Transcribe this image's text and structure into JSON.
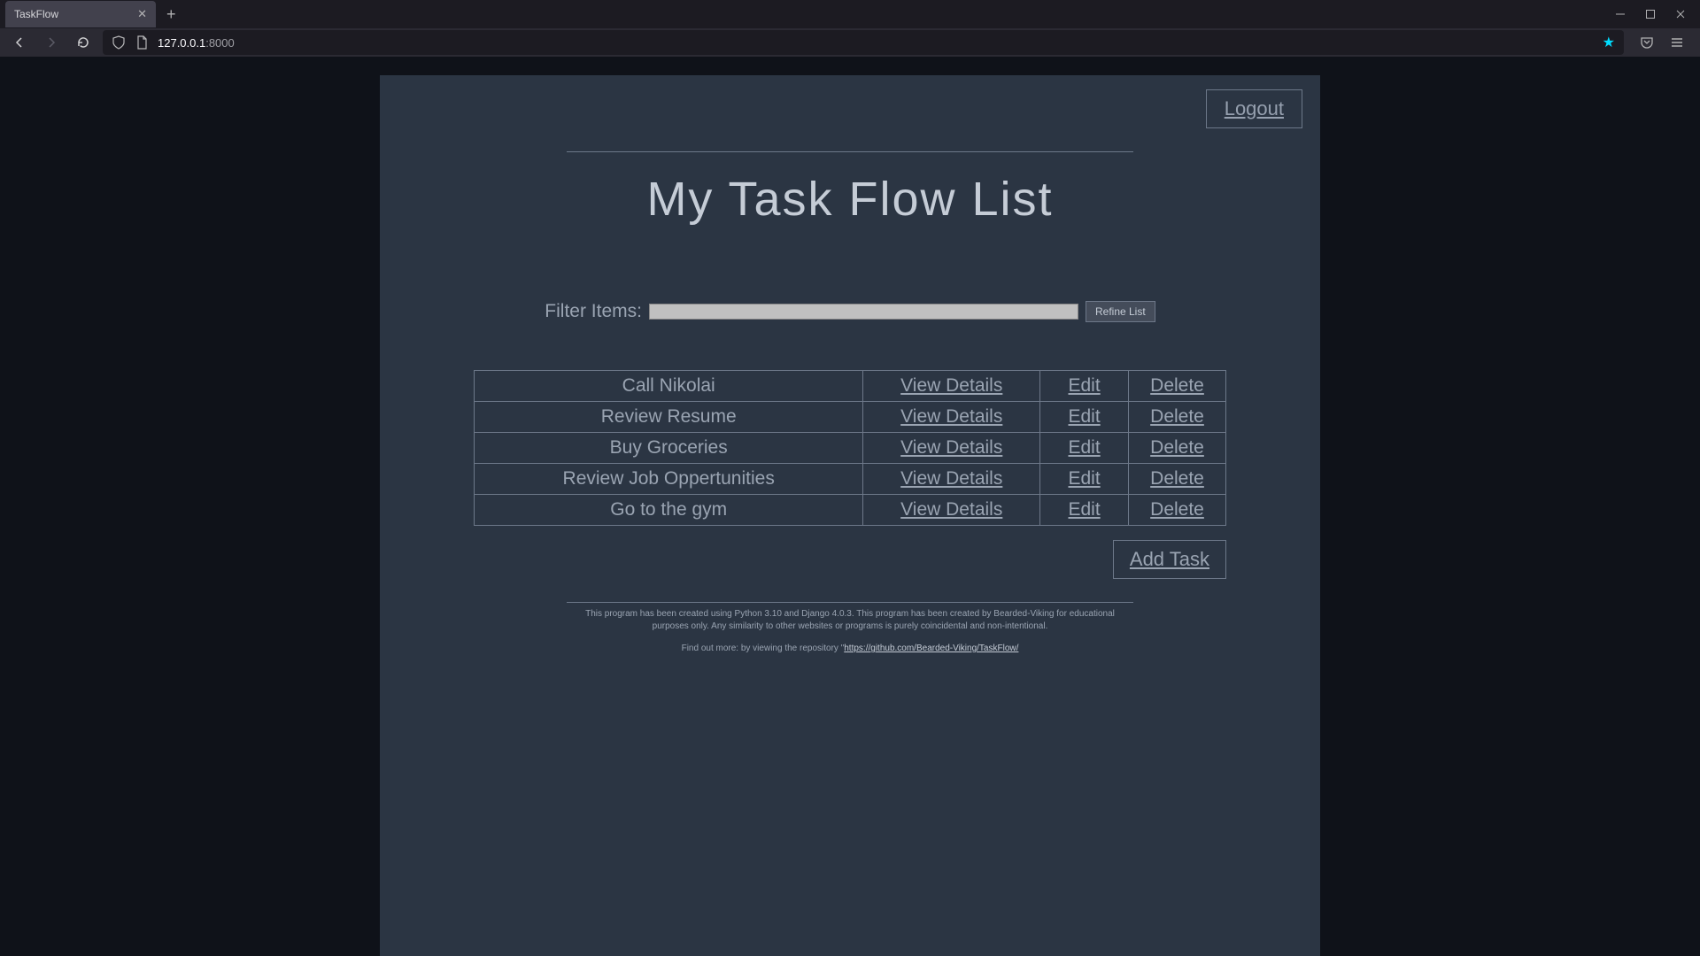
{
  "browser": {
    "tab_title": "TaskFlow",
    "url_host": "127.0.0.1",
    "url_port": ":8000"
  },
  "header": {
    "logout_label": "Logout"
  },
  "page_title": "My Task Flow List",
  "filter": {
    "label": "Filter Items:",
    "value": "",
    "refine_label": "Refine List"
  },
  "task_actions": {
    "view": "View Details",
    "edit": "Edit",
    "delete": "Delete"
  },
  "tasks": [
    {
      "title": "Call Nikolai"
    },
    {
      "title": "Review Resume"
    },
    {
      "title": "Buy Groceries"
    },
    {
      "title": "Review Job Oppertunities"
    },
    {
      "title": "Go to the gym"
    }
  ],
  "footer": {
    "add_label": "Add Task",
    "disclaimer": "This program has been created using Python 3.10 and Django 4.0.3. This program has been created by Bearded-Viking for educational purposes only. Any similarity to other websites or programs is purely coincidental and non-intentional.",
    "find_out_prefix": "Find out more: by viewing the repository ",
    "repo_quote": "\"",
    "repo_url": "https://github.com/Bearded-Viking/TaskFlow/"
  }
}
